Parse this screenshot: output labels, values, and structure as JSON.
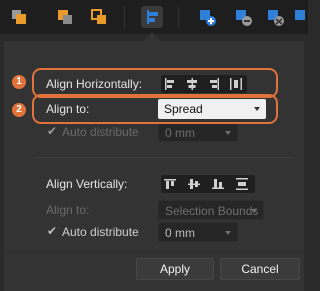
{
  "colors": {
    "accent": "#e0733b",
    "toolbar": "#1e1e1e",
    "panel": "#333333",
    "icon_blue": "#2f7fd8",
    "icon_orange": "#e89a2a"
  },
  "toolbar": {
    "icons": [
      "arrange-front-icon",
      "arrange-forward-icon",
      "arrange-back-icon",
      "align-icon",
      "add-node-icon",
      "subtract-icon",
      "intersect-icon",
      "divide-icon"
    ]
  },
  "callouts": {
    "one": "1",
    "two": "2"
  },
  "horizontal": {
    "label": "Align Horizontally:",
    "align_to_label": "Align to:",
    "align_to_value": "Spread",
    "auto_distribute_label": "Auto distribute",
    "spacing_value": "0 mm"
  },
  "vertical": {
    "label": "Align Vertically:",
    "align_to_label": "Align to:",
    "align_to_value": "Selection Bounds",
    "auto_distribute_label": "Auto distribute",
    "spacing_value": "0 mm"
  },
  "buttons": {
    "apply": "Apply",
    "cancel": "Cancel"
  }
}
